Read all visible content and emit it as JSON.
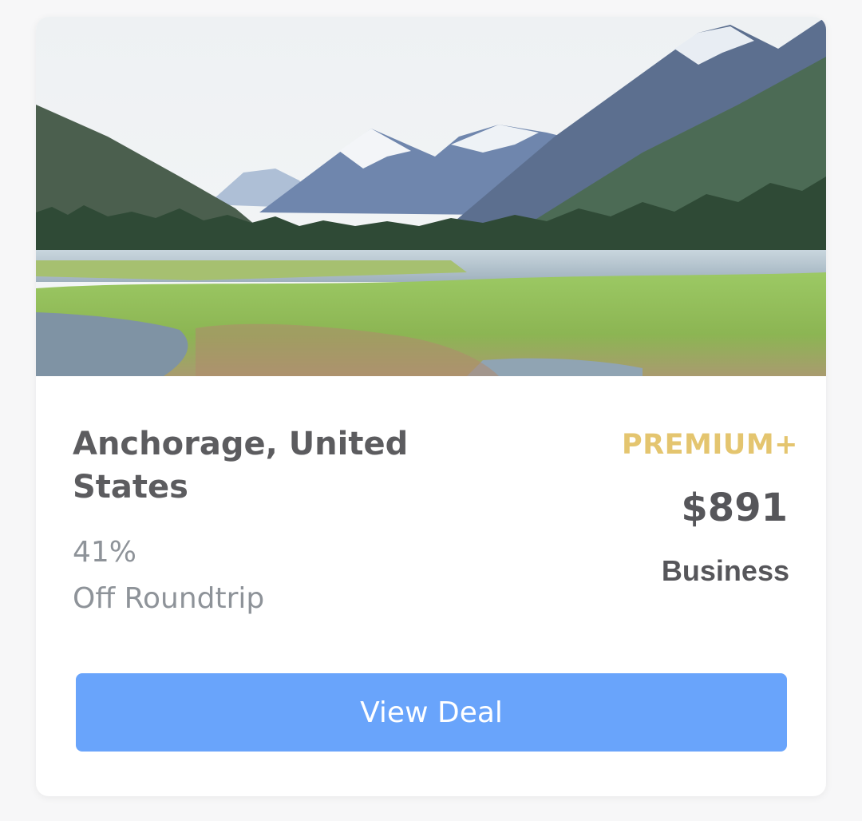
{
  "deal": {
    "destination": "Anchorage, United States",
    "discount_percent": "41%",
    "discount_label": "Off Roundtrip",
    "tier": "PREMIUM+",
    "price": "$891",
    "cabin_class": "Business",
    "cta_label": "View Deal"
  },
  "colors": {
    "tier": "#e4c56f",
    "cta_background": "#69a4fb",
    "title": "#5c5c5f",
    "muted": "#8e9399"
  }
}
